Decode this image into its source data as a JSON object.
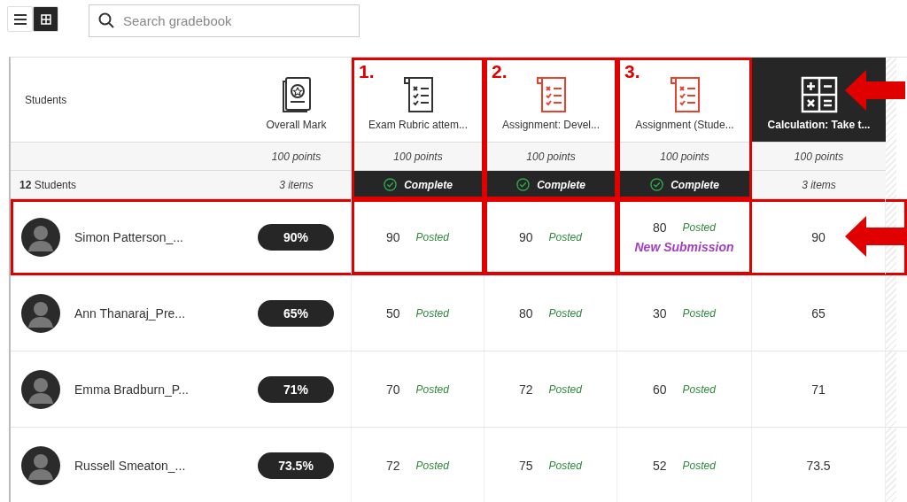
{
  "view_toggle": [
    {
      "kind": "list",
      "selected": false
    },
    {
      "kind": "grid",
      "selected": true
    }
  ],
  "search": {
    "placeholder": "Search gradebook"
  },
  "students_column": {
    "title": "Students",
    "summary": "**12** Students"
  },
  "columns": [
    {
      "kind": "overall",
      "title": "Overall Mark",
      "points": "100 points",
      "summary": "3 items",
      "complete": false,
      "selected": false
    },
    {
      "kind": "item",
      "title": "Exam Rubric attem...",
      "points": "100 points",
      "summary": "Complete",
      "complete": true,
      "selected": false,
      "callout": "1.",
      "color": "#333333"
    },
    {
      "kind": "item",
      "title": "Assignment: Devel...",
      "points": "100 points",
      "summary": "Complete",
      "complete": true,
      "selected": false,
      "callout": "2.",
      "color": "#e8412c"
    },
    {
      "kind": "item",
      "title": "Assignment (Stude...",
      "points": "100 points",
      "summary": "Complete",
      "complete": true,
      "selected": false,
      "callout": "3.",
      "color": "#e8412c"
    },
    {
      "kind": "calculation",
      "title": "Calculation: Take t...",
      "points": "100 points",
      "summary": "3 items",
      "complete": false,
      "selected": true,
      "arrow": true
    }
  ],
  "rows": [
    {
      "name": "Simon Patterson_...",
      "overall": "90%",
      "highlighted": true,
      "arrow": true,
      "grades": [
        {
          "score": "90",
          "status": "Posted"
        },
        {
          "score": "90",
          "status": "Posted"
        },
        {
          "score": "80",
          "status": "Posted",
          "note": "New Submission"
        }
      ],
      "calculation": "90"
    },
    {
      "name": "Ann Thanaraj_Pre...",
      "overall": "65%",
      "highlighted": false,
      "grades": [
        {
          "score": "50",
          "status": "Posted"
        },
        {
          "score": "80",
          "status": "Posted"
        },
        {
          "score": "30",
          "status": "Posted"
        }
      ],
      "calculation": "65"
    },
    {
      "name": "Emma Bradburn_P...",
      "overall": "71%",
      "highlighted": false,
      "grades": [
        {
          "score": "70",
          "status": "Posted"
        },
        {
          "score": "72",
          "status": "Posted"
        },
        {
          "score": "60",
          "status": "Posted"
        }
      ],
      "calculation": "71"
    },
    {
      "name": "Russell Smeaton_...",
      "overall": "73.5%",
      "highlighted": false,
      "grades": [
        {
          "score": "72",
          "status": "Posted"
        },
        {
          "score": "75",
          "status": "Posted"
        },
        {
          "score": "52",
          "status": "Posted"
        }
      ],
      "calculation": "73.5"
    }
  ]
}
